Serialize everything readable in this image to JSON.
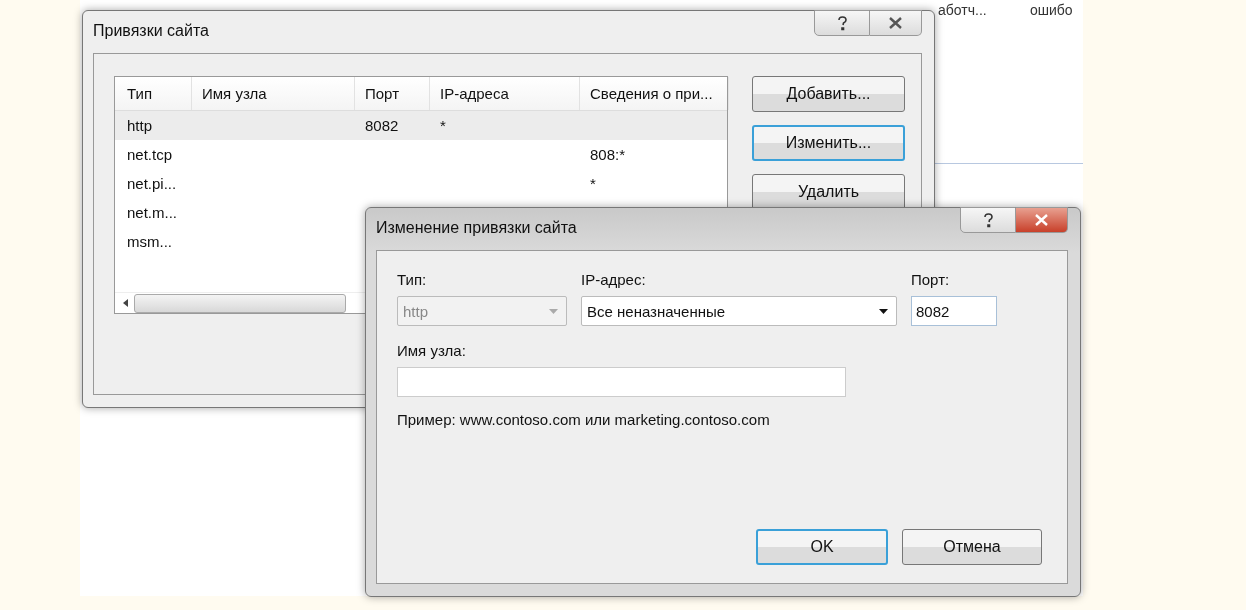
{
  "background": {
    "texts": [
      "аботч...",
      "ошибо"
    ]
  },
  "bindings_dialog": {
    "title": "Привязки сайта",
    "columns": [
      "Тип",
      "Имя узла",
      "Порт",
      "IP-адреса",
      "Сведения о при..."
    ],
    "rows": [
      {
        "type": "http",
        "port": "8082",
        "ip": "*",
        "selected": true
      },
      {
        "type": "net.tcp",
        "info": "808:*",
        "selected": false
      },
      {
        "type": "net.pi...",
        "info": "*",
        "selected": false
      },
      {
        "type": "net.m...",
        "selected": false
      },
      {
        "type": "msm...",
        "selected": false
      }
    ],
    "buttons": [
      {
        "label": "Добавить...",
        "focused": false
      },
      {
        "label": "Изменить...",
        "focused": true
      },
      {
        "label": "Удалить",
        "focused": false
      }
    ]
  },
  "edit_dialog": {
    "title": "Изменение привязки сайта",
    "type_field": {
      "label": "Тип:",
      "value": "http",
      "disabled": true
    },
    "ip_field": {
      "label": "IP-адрес:",
      "value": "Все неназначенные"
    },
    "port_field": {
      "label": "Порт:",
      "value": "8082"
    },
    "host_field": {
      "label": "Имя узла:"
    },
    "example": "Пример: www.contoso.com или marketing.contoso.com",
    "buttons": [
      {
        "label": "OK",
        "default": true
      },
      {
        "label": "Отмена",
        "default": false
      }
    ]
  }
}
